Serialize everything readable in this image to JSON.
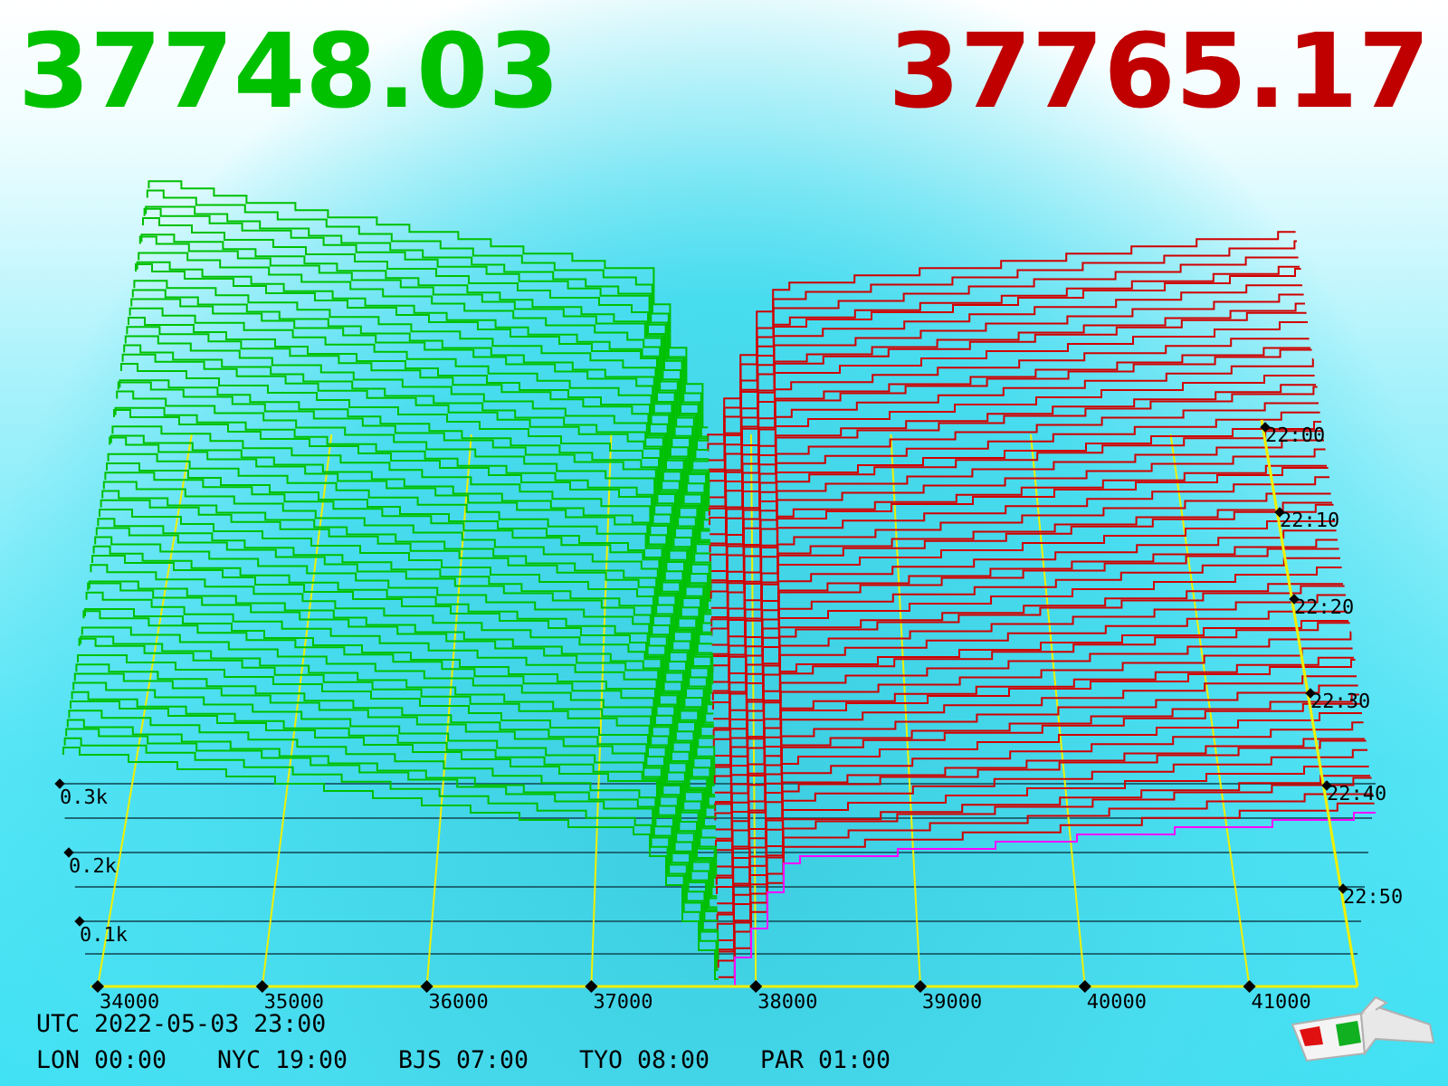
{
  "bid_price": "37748.03",
  "ask_price": "37765.17",
  "price_axis": [
    "34000",
    "35000",
    "36000",
    "37000",
    "38000",
    "39000",
    "40000",
    "41000"
  ],
  "depth_axis": [
    "0.3k",
    "0.2k",
    "0.1k"
  ],
  "time_axis": [
    "22:00",
    "22:10",
    "22:20",
    "22:30",
    "22:40",
    "22:50"
  ],
  "clock": {
    "utc": "UTC 2022-05-03 23:00",
    "cities": [
      "LON 00:00",
      "NYC 19:00",
      "BJS 07:00",
      "TYO 08:00",
      "PAR 01:00"
    ]
  }
}
